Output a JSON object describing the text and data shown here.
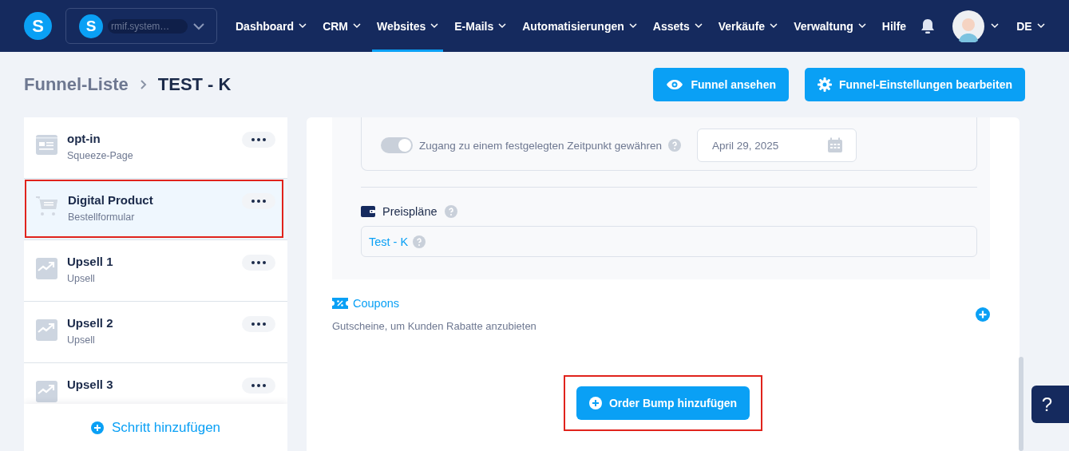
{
  "nav": {
    "logo": "S",
    "workspace": {
      "logo": "S",
      "name": "rmif.system…"
    },
    "items": [
      {
        "label": "Dashboard",
        "dropdown": true,
        "selected": false
      },
      {
        "label": "CRM",
        "dropdown": true,
        "selected": false
      },
      {
        "label": "Websites",
        "dropdown": true,
        "selected": true
      },
      {
        "label": "E-Mails",
        "dropdown": true,
        "selected": false
      },
      {
        "label": "Automatisierungen",
        "dropdown": true,
        "selected": false
      },
      {
        "label": "Assets",
        "dropdown": true,
        "selected": false
      },
      {
        "label": "Verkäufe",
        "dropdown": true,
        "selected": false
      },
      {
        "label": "Verwaltung",
        "dropdown": true,
        "selected": false
      },
      {
        "label": "Hilfe",
        "dropdown": false,
        "selected": false
      }
    ],
    "language": "DE"
  },
  "breadcrumb": {
    "parent": "Funnel-Liste",
    "current": "TEST - K"
  },
  "actions": [
    {
      "label": "Funnel ansehen",
      "kind": "eye"
    },
    {
      "label": "Funnel-Einstellungen bearbeiten",
      "kind": "gear"
    }
  ],
  "steps": [
    {
      "title": "opt-in",
      "subtitle": "Squeeze-Page",
      "kind": "form",
      "selected": false,
      "highlighted": false
    },
    {
      "title": "Digital Product",
      "subtitle": "Bestellformular",
      "kind": "cart",
      "selected": true,
      "highlighted": true
    },
    {
      "title": "Upsell 1",
      "subtitle": "Upsell",
      "kind": "trend",
      "selected": false,
      "highlighted": false
    },
    {
      "title": "Upsell 2",
      "subtitle": "Upsell",
      "kind": "trend",
      "selected": false,
      "highlighted": false
    },
    {
      "title": "Upsell 3",
      "kind": "trend",
      "selected": false,
      "highlighted": false
    }
  ],
  "add_step": "Schritt hinzufügen",
  "access": {
    "label": "Zugang zu einem festgelegten Zeitpunkt gewähren",
    "on": true,
    "disabled": true,
    "date": "April 29, 2025"
  },
  "pricing": {
    "title": "Preispläne",
    "plan": "Test - K"
  },
  "coupons": {
    "title": "Coupons",
    "description": "Gutscheine, um Kunden Rabatte anzubieten"
  },
  "order_bump": {
    "label": "Order Bump hinzufügen",
    "highlighted": true
  },
  "help": "?"
}
